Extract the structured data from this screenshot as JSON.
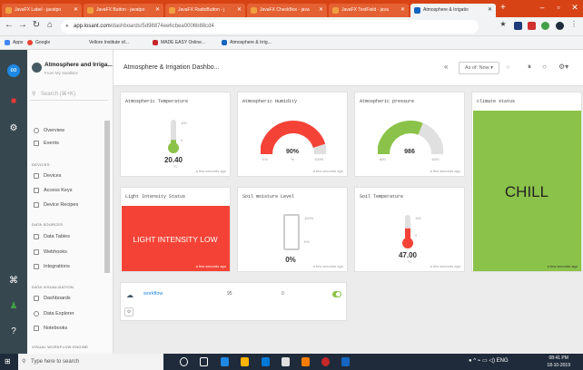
{
  "browser": {
    "tabs": [
      {
        "label": "JavaFX Label - javatpo"
      },
      {
        "label": "JavaFX Button - javatpo"
      },
      {
        "label": "JavaFX RadioButton - j"
      },
      {
        "label": "JavaFX CheckBox - java"
      },
      {
        "label": "JavaFX TextField - java"
      },
      {
        "label": "Atmosphere & Irrigatio"
      }
    ],
    "new_tab": "+",
    "url_host": "app.losant.com",
    "url_path": "/dashboards/5d98874ee6cbea0006b88cd4",
    "bookmarks": [
      "Apps",
      "Google",
      "Vellore Institute of...",
      "MADE EASY Online...",
      "Atmosphere & Irrig..."
    ]
  },
  "sidebar": {
    "app_name": "Atmosphere and Irriga...",
    "app_sub": "From My Sandbox",
    "search_placeholder": "Search (⌘+K)",
    "top_items": [
      "Overview",
      "Events"
    ],
    "devices_header": "DEVICES",
    "device_items": [
      "Devices",
      "Access Keys",
      "Device Recipes"
    ],
    "data_header": "DATA SOURCES",
    "data_items": [
      "Data Tables",
      "Webhooks",
      "Integrations"
    ],
    "viz_header": "DATA VISUALIZATION",
    "viz_items": [
      "Dashboards",
      "Data Explorer",
      "Notebooks"
    ],
    "workflow_header": "VISUAL WORKFLOW ENGINE"
  },
  "topbar": {
    "title": "Atmosphere & Irrigation Dashbo...",
    "as_of": "As of: Now ▾"
  },
  "cards": {
    "temperature": {
      "title": "Atmospheric Temperature",
      "value": "20.40",
      "unit": "°C",
      "scale_max": "100",
      "scale_mid": "0",
      "updated": "a few seconds ago",
      "level": 0.204
    },
    "humidity": {
      "title": "Atmospheric Humidity",
      "value": "90%",
      "unit": "%",
      "min": "0%",
      "max": "100%",
      "updated": "a few seconds ago",
      "level": 0.9
    },
    "pressure": {
      "title": "Atmospheric pressure",
      "value": "986",
      "min": "800",
      "max": "1100",
      "updated": "a few seconds ago",
      "level": 0.62
    },
    "climate": {
      "title": "climate status",
      "value": "CHILL",
      "updated": "a few seconds ago"
    },
    "light": {
      "title": "Light Intensity Status",
      "value": "LIGHT INTENSITY LOW",
      "updated": "a few seconds ago"
    },
    "soil": {
      "title": "Soil moisture Level",
      "value": "0%",
      "scale_max": "100%",
      "scale_mid": "0%",
      "updated": "a few seconds ago",
      "level": 0.0
    },
    "soil_temp": {
      "title": "Soil Temperature",
      "value": "47.00",
      "unit": "°C",
      "scale_max": "100",
      "scale_mid": "0",
      "updated": "a few seconds ago",
      "level": 0.47
    },
    "workflow": {
      "name": "workflow",
      "count": "95",
      "errors": "0"
    }
  },
  "taskbar": {
    "search": "Type here to search",
    "time": "08:41 PM",
    "date": "18-10-2019",
    "lang": "ENG"
  },
  "colors": {
    "red": "#f44336",
    "green": "#8bc34a",
    "grey": "#e0e0e0"
  }
}
